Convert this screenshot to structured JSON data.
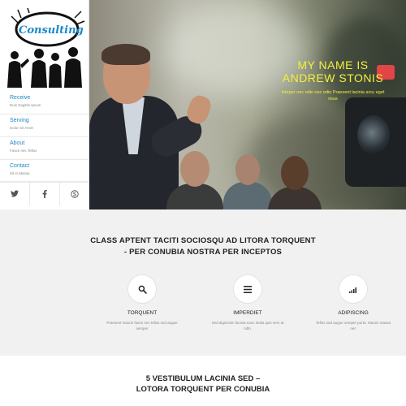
{
  "hero": {
    "title_line1": "MY NAME IS",
    "title_line2": "ANDREW STONIS",
    "subtitle": "Integer nec odio nec odio Praesent lacinia arcu eget risus"
  },
  "sidebar": {
    "logo_text": "Consulting",
    "items": [
      {
        "label": "Receive",
        "sub": "Duis Sagittis Ipsum"
      },
      {
        "label": "Serving",
        "sub": "Dolor Sit Amet"
      },
      {
        "label": "About",
        "sub": "Fusce nec Tellus"
      },
      {
        "label": "Contact",
        "sub": "Sit in Massa"
      }
    ],
    "social": [
      "twitter-icon",
      "facebook-icon",
      "skype-icon"
    ]
  },
  "intro": {
    "title": "CLASS APTENT TACITI SOCIOSQU AD LITORA TORQUENT - PER CONUBIA NOSTRA PER INCEPTOS",
    "features": [
      {
        "icon": "search-icon",
        "title": "TORQUENT",
        "text": "Praesent mauris fusce nec tellus sed augue semper"
      },
      {
        "icon": "menu-icon",
        "title": "IMPERDIET",
        "text": "Sed dignissim lacinia nunc Nulla quis sem at nibh."
      },
      {
        "icon": "signal-icon",
        "title": "ADIPISCING",
        "text": "Tellus sed augue semper porta. Mauris massa nec"
      }
    ]
  },
  "bottom": {
    "title_line1": "5 VESTIBULUM LACINIA SED –",
    "title_line2": "LOTORA TORQUENT PER CONUBIA"
  },
  "colors": {
    "accent_blue": "#1e88c8",
    "hero_yellow": "#f1f13a"
  }
}
